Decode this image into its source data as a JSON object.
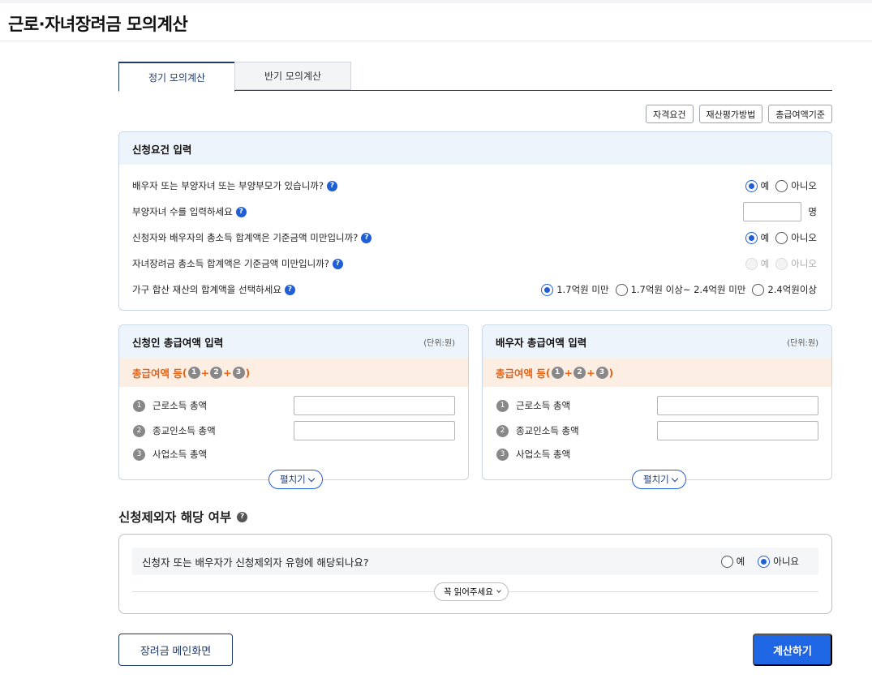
{
  "page": {
    "title": "근로·자녀장려금 모의계산"
  },
  "tabs": [
    {
      "label": "정기 모의계산",
      "active": true
    },
    {
      "label": "반기 모의계산",
      "active": false
    }
  ],
  "tool_buttons": [
    "자격요건",
    "재산평가방법",
    "총급여액기준"
  ],
  "requirements": {
    "title": "신청요건 입력",
    "q1": {
      "text": "배우자 또는 부양자녀 또는 부양부모가 있습니까?",
      "yes": "예",
      "no": "아니오",
      "selected": "yes"
    },
    "q2": {
      "text": "부양자녀 수를 입력하세요",
      "value": "",
      "unit": "명"
    },
    "q3": {
      "text": "신청자와 배우자의 총소득 합계액은 기준금액 미만입니까?",
      "yes": "예",
      "no": "아니오",
      "selected": "yes"
    },
    "q4": {
      "text": "자녀장려금 총소득 합계액은 기준금액 미만입니까?",
      "yes": "예",
      "no": "아니오",
      "disabled": true
    },
    "q5": {
      "text": "가구 합산 재산의 합계액을 선택하세요",
      "opt1": "1.7억원 미만",
      "opt2": "1.7억원 이상~ 2.4억원 미만",
      "opt3": "2.4억원이상",
      "selected": "opt1"
    }
  },
  "applicant": {
    "title": "신청인 총급여액 입력",
    "unit": "(단위:원)",
    "total_label": "총급여액 등",
    "items": [
      {
        "num": "1",
        "label": "근로소득 총액",
        "value": ""
      },
      {
        "num": "2",
        "label": "종교인소득 총액",
        "value": ""
      },
      {
        "num": "3",
        "label": "사업소득 총액"
      }
    ],
    "expand": "펼치기"
  },
  "spouse": {
    "title": "배우자 총급여액 입력",
    "unit": "(단위:원)",
    "total_label": "총급여액 등",
    "items": [
      {
        "num": "1",
        "label": "근로소득 총액",
        "value": ""
      },
      {
        "num": "2",
        "label": "종교인소득 총액",
        "value": ""
      },
      {
        "num": "3",
        "label": "사업소득 총액"
      }
    ],
    "expand": "펼치기"
  },
  "exclusion": {
    "title": "신청제외자 해당 여부",
    "question": "신청자 또는 배우자가 신청제외자 유형에 해당되나요?",
    "yes": "예",
    "no": "아니요",
    "selected": "no",
    "read_label": "꼭 읽어주세요"
  },
  "footer": {
    "main_button": "장려금 메인화면",
    "calc_button": "계산하기"
  },
  "colors": {
    "primary": "#1f66e5",
    "navy": "#1e3a6e",
    "orange": "#e0651a",
    "panel_head": "#eef4fc"
  }
}
